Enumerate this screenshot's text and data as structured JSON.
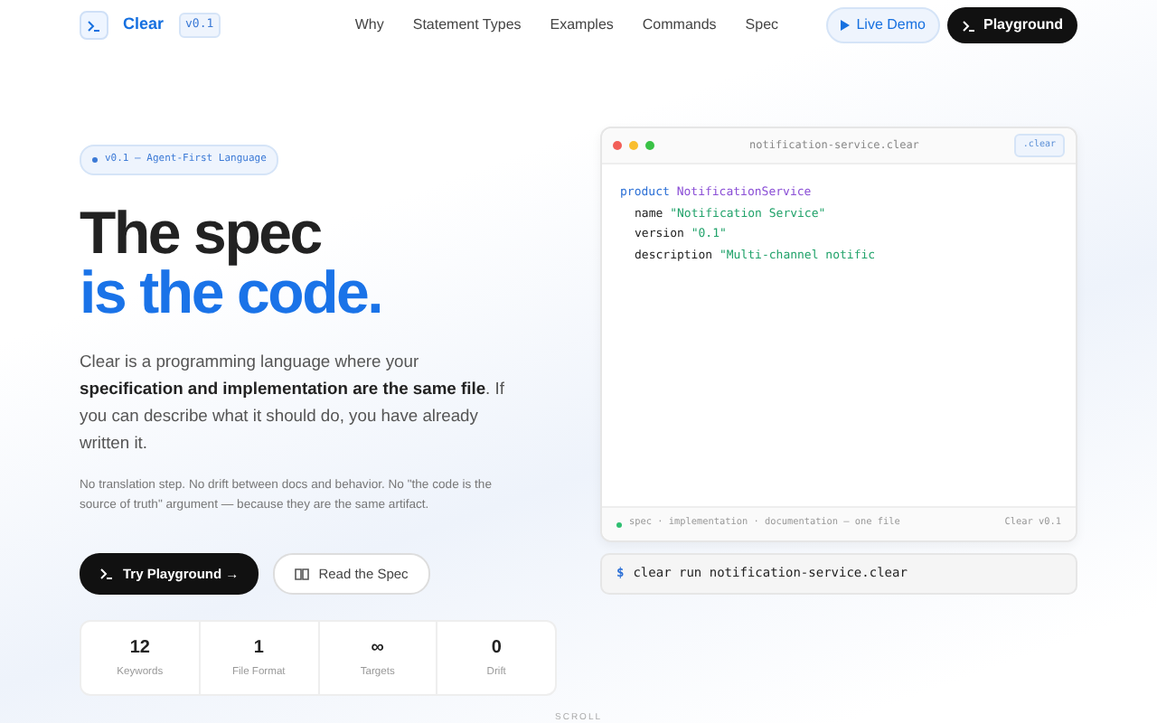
{
  "navbar": {
    "brand": "Clear",
    "version": "v0.1",
    "links": [
      "Why",
      "Statement Types",
      "Examples",
      "Commands",
      "Spec"
    ],
    "buttons": [
      {
        "kind": "light",
        "label": "Live Demo"
      },
      {
        "kind": "dark",
        "label": "Playground"
      }
    ]
  },
  "hero": {
    "badge": "v0.1 — Agent-First Language",
    "title_line_1": "The spec",
    "title_line_2": "is the code.",
    "lead": "Clear is a programming language where your **specification and implementation are the same file**. If you can describe what it should do, you have already written it.",
    "note": "No translation step. No drift between docs and behavior. No \"the code is the source of truth\" argument — because they are the same artifact.",
    "buttons": [
      {
        "kind": "primary",
        "label": "Try Playground →"
      },
      {
        "kind": "outline",
        "label": "Read the Spec"
      }
    ],
    "stats": [
      {
        "value": "12",
        "label": "Keywords"
      },
      {
        "value": "1",
        "label": "File Format"
      },
      {
        "value": "∞",
        "label": "Targets"
      },
      {
        "value": "0",
        "label": "Drift"
      }
    ]
  },
  "editor": {
    "filename": "notification-service.clear",
    "tag": ".clear",
    "lines": [
      {
        "tokens": [
          {
            "kind": "keyword",
            "text": "product"
          },
          {
            "kind": "type",
            "text": "NotificationService"
          }
        ],
        "children": [
          {
            "tokens": [
              {
                "kind": "plain",
                "text": "name"
              },
              {
                "kind": "string",
                "text": "\"Notification Service\""
              }
            ]
          },
          {
            "tokens": [
              {
                "kind": "plain",
                "text": "version"
              },
              {
                "kind": "string",
                "text": "\"0.1\""
              }
            ]
          },
          {
            "tokens": [
              {
                "kind": "plain",
                "text": "description"
              },
              {
                "kind": "string",
                "text": "\"Multi-channel notific"
              }
            ]
          }
        ]
      }
    ],
    "footer_left": "spec · implementation · documentation — one file",
    "footer_right": "Clear v0.1"
  },
  "terminal": {
    "prompt": "$",
    "command": "clear run notification-service.clear"
  },
  "scroll_hint": "SCROLL"
}
